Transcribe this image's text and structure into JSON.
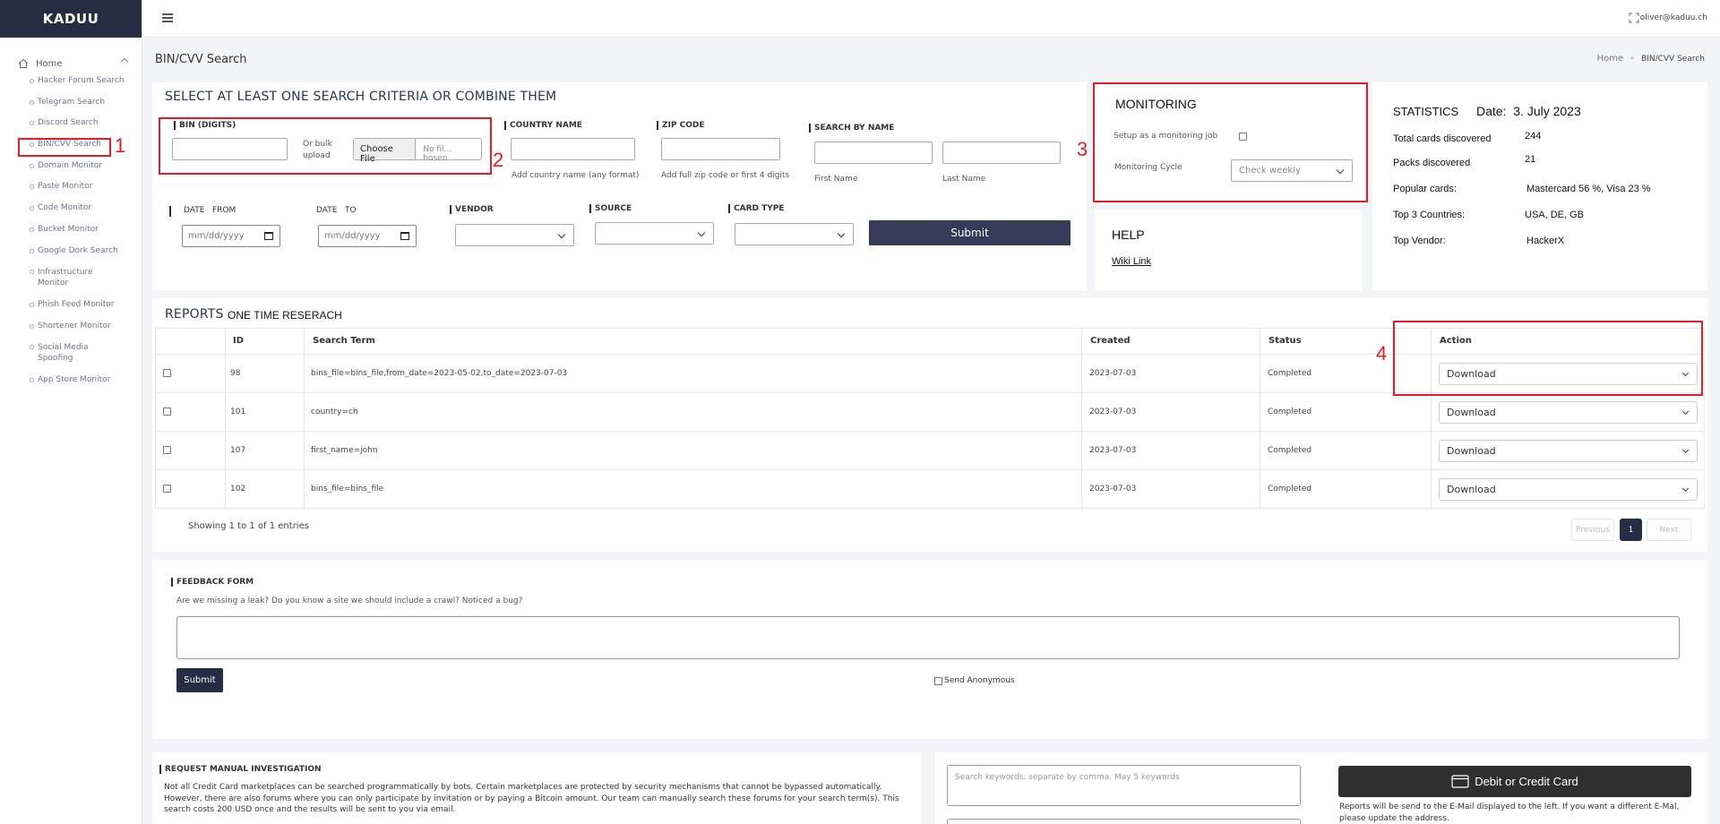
{
  "brand": "KADUU",
  "user_email": "oliver@kaduu.ch",
  "sidebar": {
    "home_label": "Home",
    "items": [
      {
        "label": "Hacker Forum Search"
      },
      {
        "label": "Telegram Search"
      },
      {
        "label": "Discord Search"
      },
      {
        "label": "BIN/CVV Search"
      },
      {
        "label": "Domain Monitor"
      },
      {
        "label": "Paste Monitor"
      },
      {
        "label": "Code Monitor"
      },
      {
        "label": "Bucket Monitor"
      },
      {
        "label": "Google Dork Search"
      },
      {
        "label": "Infrastructure Monitor"
      },
      {
        "label": "Phish Feed Monitor"
      },
      {
        "label": "Shortener Monitor"
      },
      {
        "label": "Social Media Spoofing"
      },
      {
        "label": "App Store Monitor"
      }
    ]
  },
  "page": {
    "title": "BIN/CVV Search",
    "breadcrumb_home": "Home",
    "breadcrumb_current": "BIN/CVV Search"
  },
  "annotations": [
    "1",
    "2",
    "3",
    "4"
  ],
  "search": {
    "heading": "SELECT AT LEAST ONE SEARCH CRITERIA OR COMBINE THEM",
    "bin_label": "BIN (DIGITS)",
    "bulk_label": "Or bulk upload",
    "choose_file": "Choose File",
    "no_file": "No fil…hosen",
    "country_label": "COUNTRY NAME",
    "country_help": "Add country name (any format)",
    "zip_label": "ZIP CODE",
    "zip_help": "Add full zip code or first 4 digits",
    "name_label": "SEARCH BY NAME",
    "first_name": "First Name",
    "last_name": "Last Name",
    "date_label": "DATE",
    "from_label": "FROM",
    "to_label": "TO",
    "date_placeholder": "mm/dd/yyyy",
    "vendor_label": "VENDOR",
    "source_label": "SOURCE",
    "card_type_label": "CARD TYPE",
    "submit": "Submit"
  },
  "monitoring": {
    "heading": "MONITORING",
    "setup_label": "Setup as a monitoring job",
    "cycle_label": "Monitoring Cycle",
    "cycle_value": "Check weekly"
  },
  "help": {
    "heading": "HELP",
    "link": "Wiki Link"
  },
  "statistics": {
    "heading": "STATISTICS",
    "date_label": "Date:",
    "date_value": "3. July 2023",
    "rows": [
      {
        "label": "Total cards discovered",
        "value": "244"
      },
      {
        "label": "Packs discovered",
        "value": "21"
      },
      {
        "label": "Popular cards:",
        "value": "Mastercard 56 %, Visa 23 %"
      },
      {
        "label": "Top 3 Countries:",
        "value": "USA, DE, GB"
      },
      {
        "label": "Top Vendor:",
        "value": "HackerX"
      }
    ]
  },
  "reports": {
    "heading": "REPORTS",
    "subheading": "ONE TIME RESERACH",
    "columns": [
      "ID",
      "Search Term",
      "Created",
      "Status",
      "Action"
    ],
    "rows": [
      {
        "id": "98",
        "term": "bins_file=bins_file,from_date=2023-05-02,to_date=2023-07-03",
        "created": "2023-07-03",
        "status": "Completed",
        "action": "Download"
      },
      {
        "id": "101",
        "term": "country=ch",
        "created": "2023-07-03",
        "status": "Completed",
        "action": "Download"
      },
      {
        "id": "107",
        "term": "first_name=john",
        "created": "2023-07-03",
        "status": "Completed",
        "action": "Download"
      },
      {
        "id": "102",
        "term": "bins_file=bins_file",
        "created": "2023-07-03",
        "status": "Completed",
        "action": "Download"
      }
    ],
    "showing": "Showing 1 to 1 of 1 entries",
    "prev": "Previous",
    "page": "1",
    "next": "Next"
  },
  "feedback": {
    "heading": "FEEDBACK FORM",
    "question": "Are we missing a leak? Do you know a site we should include a crawl? Noticed a bug?",
    "submit": "Submit",
    "anonymous": "Send Anonymous"
  },
  "manual": {
    "heading": "REQUEST MANUAL INVESTIGATION",
    "text": "Not all Credit Card marketplaces can be searched programmatically by bots. Certain marketplaces are protected by security mechanisms that cannot be bypassed automatically. However, there are also forums where you can only participate by invitation or by paying a Bitcoin amount. Our team can manually search these forums for your search term(s). This search costs 200 USD once and the results will be sent to you via email.",
    "keywords_placeholder": "Search keywords: separate by comma. May 5 keywords",
    "pay_button": "Debit or Credit Card",
    "pay_note": "Reports will be send to the E-Mail displayed to the left. If you want a different E-Mal, please update the address."
  }
}
